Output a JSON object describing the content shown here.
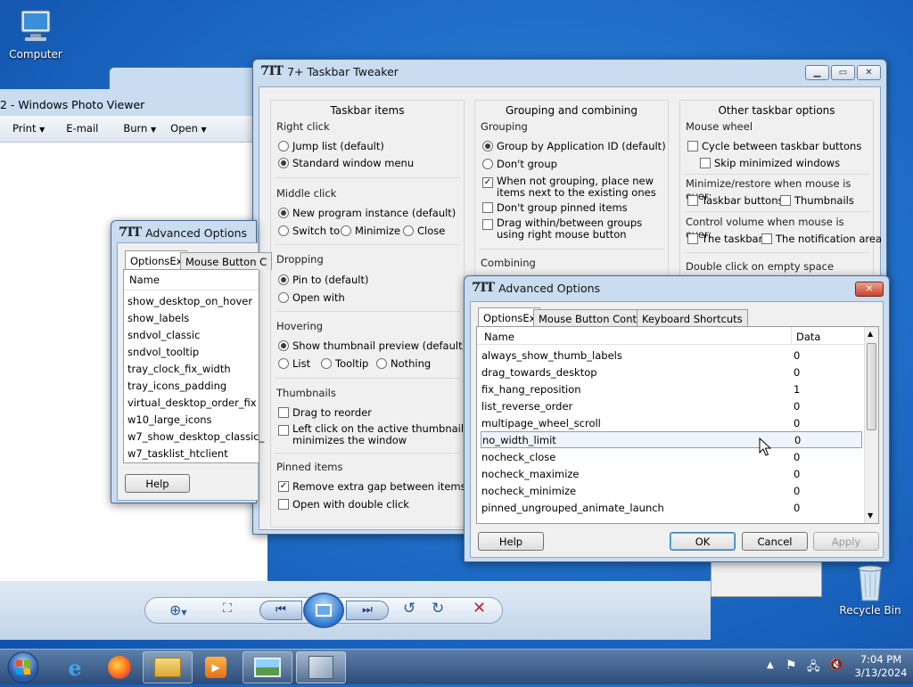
{
  "desktop": {
    "computer_label": "Computer",
    "recycle_label": "Recycle Bin"
  },
  "photo_viewer": {
    "title": "2 - Windows Photo Viewer",
    "menu": [
      "Print",
      "E-mail",
      "Burn",
      "Open"
    ]
  },
  "tweaker": {
    "logo": "7TT",
    "title": "7+ Taskbar Tweaker",
    "col1": {
      "header": "Taskbar items",
      "right_click": "Right click",
      "jump_list": "Jump list (default)",
      "standard_menu": "Standard window menu",
      "middle_click": "Middle click",
      "new_instance": "New program instance (default)",
      "switch_to": "Switch to",
      "minimize": "Minimize",
      "close": "Close",
      "dropping": "Dropping",
      "pin_to": "Pin to (default)",
      "open_with": "Open with",
      "hovering": "Hovering",
      "show_preview": "Show thumbnail preview (default)",
      "list": "List",
      "tooltip": "Tooltip",
      "nothing": "Nothing",
      "thumbnails": "Thumbnails",
      "drag_reorder": "Drag to reorder",
      "left_click_1": "Left click on the active thumbnail",
      "left_click_2": "minimizes the window",
      "pinned_items": "Pinned items",
      "remove_gap": "Remove extra gap between items",
      "open_double": "Open with double click"
    },
    "col2": {
      "header": "Grouping and combining",
      "grouping": "Grouping",
      "group_app": "Group by Application ID (default)",
      "dont_group": "Don't group",
      "when_not_1": "When not grouping, place new",
      "when_not_2": "items next to the existing ones",
      "dont_group_pinned": "Don't group pinned items",
      "drag_within_1": "Drag within/between groups",
      "drag_within_2": "using right mouse button",
      "combining": "Combining"
    },
    "col3": {
      "header": "Other taskbar options",
      "mouse_wheel": "Mouse wheel",
      "cycle": "Cycle between taskbar buttons",
      "skip_min": "Skip minimized windows",
      "min_restore": "Minimize/restore when mouse is over:",
      "taskbar_buttons": "Taskbar buttons",
      "thumbnails": "Thumbnails",
      "control_volume": "Control volume when mouse is over:",
      "the_taskbar": "The taskbar",
      "notification_area": "The notification area",
      "double_click": "Double click on empty space"
    }
  },
  "adv_back": {
    "logo": "7TT",
    "title": "Advanced Options",
    "tabs": [
      "OptionsEx",
      "Mouse Button C"
    ],
    "col_name": "Name",
    "rows": [
      "show_desktop_on_hover",
      "show_labels",
      "sndvol_classic",
      "sndvol_tooltip",
      "tray_clock_fix_width",
      "tray_icons_padding",
      "virtual_desktop_order_fix",
      "w10_large_icons",
      "w7_show_desktop_classic_",
      "w7_tasklist_htclient"
    ],
    "help": "Help"
  },
  "adv_front": {
    "logo": "7TT",
    "title": "Advanced Options",
    "tabs": [
      "OptionsEx",
      "Mouse Button Control",
      "Keyboard Shortcuts"
    ],
    "col_name": "Name",
    "col_data": "Data",
    "rows": [
      {
        "name": "always_show_thumb_labels",
        "data": "0"
      },
      {
        "name": "drag_towards_desktop",
        "data": "0"
      },
      {
        "name": "fix_hang_reposition",
        "data": "1"
      },
      {
        "name": "list_reverse_order",
        "data": "0"
      },
      {
        "name": "multipage_wheel_scroll",
        "data": "0"
      },
      {
        "name": "no_width_limit",
        "data": "0"
      },
      {
        "name": "nocheck_close",
        "data": "0"
      },
      {
        "name": "nocheck_maximize",
        "data": "0"
      },
      {
        "name": "nocheck_minimize",
        "data": "0"
      },
      {
        "name": "pinned_ungrouped_animate_launch",
        "data": "0"
      }
    ],
    "help": "Help",
    "ok": "OK",
    "cancel": "Cancel",
    "apply": "Apply"
  },
  "taskbar": {
    "time": "7:04 PM",
    "date": "3/13/2024"
  }
}
